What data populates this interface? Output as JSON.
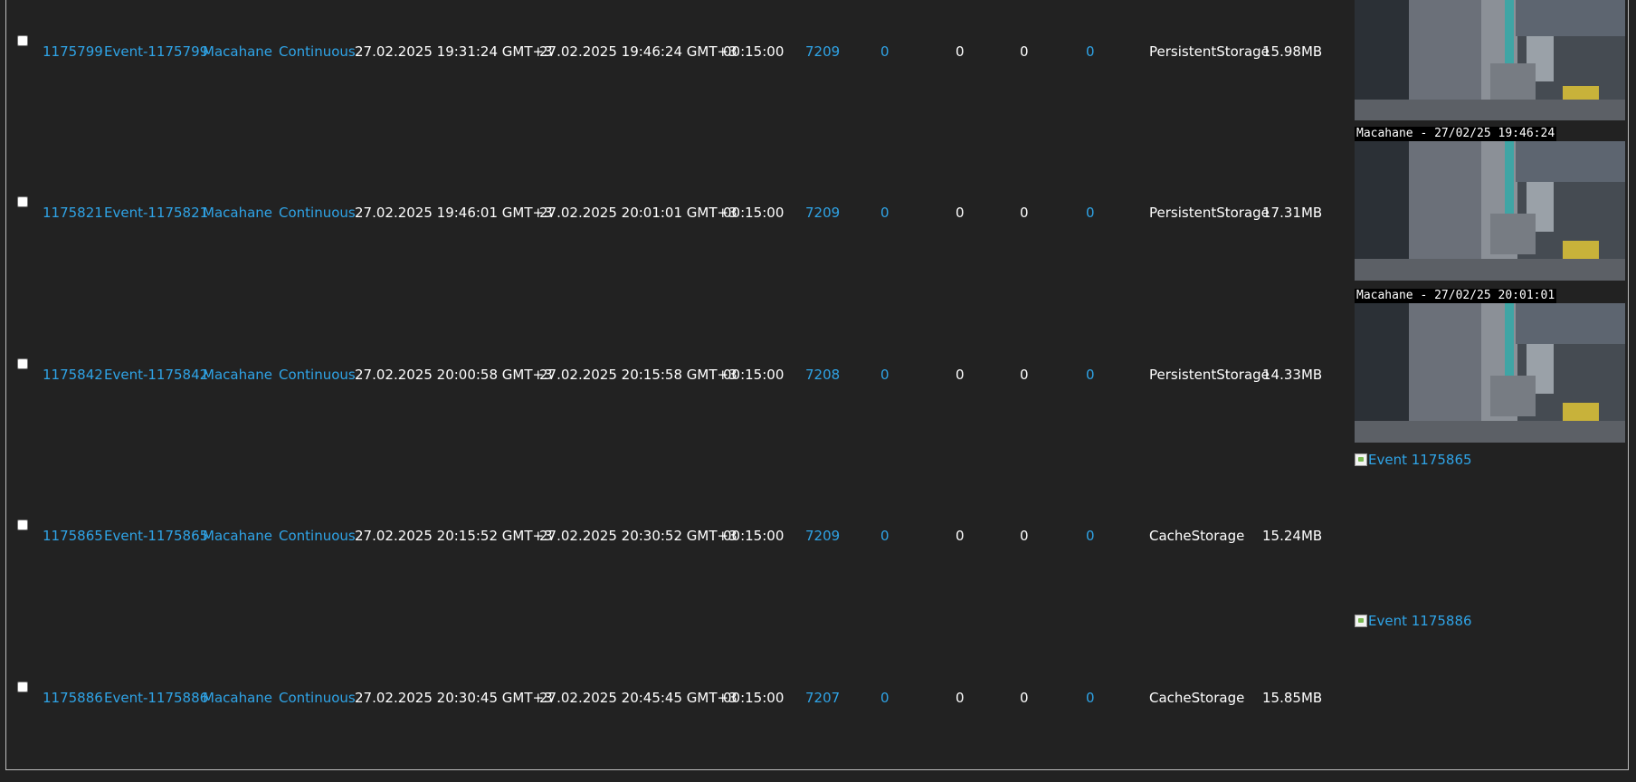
{
  "rows": [
    {
      "id": "1175799",
      "name": "Event-1175799",
      "monitor": "Macahane",
      "cause": "Continuous",
      "start": "27.02.2025 19:31:24 GMT+3",
      "end": "27.02.2025 19:46:24 GMT+3",
      "duration": "00:15:00",
      "frames": "7209",
      "alarm_frames": "0",
      "total_score": "0",
      "avg_score": "0",
      "max_score": "0",
      "storage": "PersistentStorage",
      "size": "15.98MB",
      "thumb_label": "",
      "thumb_alt": ""
    },
    {
      "id": "1175821",
      "name": "Event-1175821",
      "monitor": "Macahane",
      "cause": "Continuous",
      "start": "27.02.2025 19:46:01 GMT+3",
      "end": "27.02.2025 20:01:01 GMT+3",
      "duration": "00:15:00",
      "frames": "7209",
      "alarm_frames": "0",
      "total_score": "0",
      "avg_score": "0",
      "max_score": "0",
      "storage": "PersistentStorage",
      "size": "17.31MB",
      "thumb_label": "Macahane - 27/02/25 19:46:24",
      "thumb_alt": ""
    },
    {
      "id": "1175842",
      "name": "Event-1175842",
      "monitor": "Macahane",
      "cause": "Continuous",
      "start": "27.02.2025 20:00:58 GMT+3",
      "end": "27.02.2025 20:15:58 GMT+3",
      "duration": "00:15:00",
      "frames": "7208",
      "alarm_frames": "0",
      "total_score": "0",
      "avg_score": "0",
      "max_score": "0",
      "storage": "PersistentStorage",
      "size": "14.33MB",
      "thumb_label": "Macahane - 27/02/25 20:01:01",
      "thumb_alt": ""
    },
    {
      "id": "1175865",
      "name": "Event-1175865",
      "monitor": "Macahane",
      "cause": "Continuous",
      "start": "27.02.2025 20:15:52 GMT+3",
      "end": "27.02.2025 20:30:52 GMT+3",
      "duration": "00:15:00",
      "frames": "7209",
      "alarm_frames": "0",
      "total_score": "0",
      "avg_score": "0",
      "max_score": "0",
      "storage": "CacheStorage",
      "size": "15.24MB",
      "thumb_label": "",
      "thumb_alt": "Event 1175865"
    },
    {
      "id": "1175886",
      "name": "Event-1175886",
      "monitor": "Macahane",
      "cause": "Continuous",
      "start": "27.02.2025 20:30:45 GMT+3",
      "end": "27.02.2025 20:45:45 GMT+3",
      "duration": "00:15:00",
      "frames": "7207",
      "alarm_frames": "0",
      "total_score": "0",
      "avg_score": "0",
      "max_score": "0",
      "storage": "CacheStorage",
      "size": "15.85MB",
      "thumb_label": "",
      "thumb_alt": "Event 1175886"
    }
  ],
  "colors": {
    "background": "#222222",
    "link": "#2fa4e7",
    "text": "#ffffff",
    "border": "#bdbdbd"
  }
}
